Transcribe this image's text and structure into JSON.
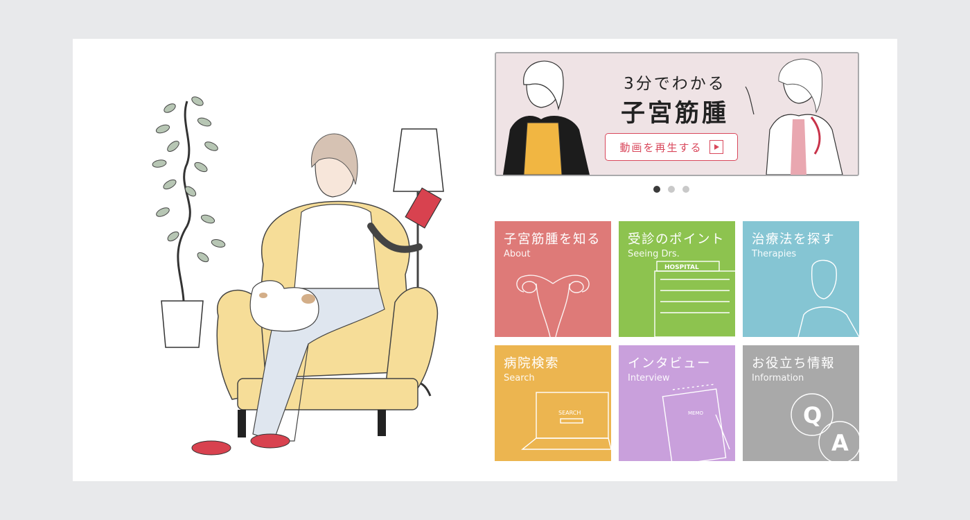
{
  "banner": {
    "subtitle": "3分でわかる",
    "title": "子宮筋腫",
    "button_label": "動画を再生する",
    "button_icon": "play-icon",
    "pink_accent": "#d9475b"
  },
  "carousel": {
    "count": 3,
    "active_index": 0
  },
  "tiles": [
    {
      "jp": "子宮筋腫を知る",
      "en": "About",
      "color": "#de7a78",
      "icon": "uterus-icon"
    },
    {
      "jp": "受診のポイント",
      "en": "Seeing Drs.",
      "color": "#8dc34f",
      "icon": "hospital-icon",
      "icon_text": "HOSPITAL"
    },
    {
      "jp": "治療法を探す",
      "en": "Therapies",
      "color": "#85c5d3",
      "icon": "doctor-icon"
    },
    {
      "jp": "病院検索",
      "en": "Search",
      "color": "#ecb550",
      "icon": "laptop-icon",
      "icon_text": "SEARCH"
    },
    {
      "jp": "インタビュー",
      "en": "Interview",
      "color": "#c9a0dc",
      "icon": "notepad-icon",
      "icon_text": "MEMO"
    },
    {
      "jp": "お役立ち情報",
      "en": "Information",
      "color": "#a9a9a9",
      "icon": "qa-icon",
      "icon_text": [
        "Q",
        "A"
      ]
    }
  ]
}
